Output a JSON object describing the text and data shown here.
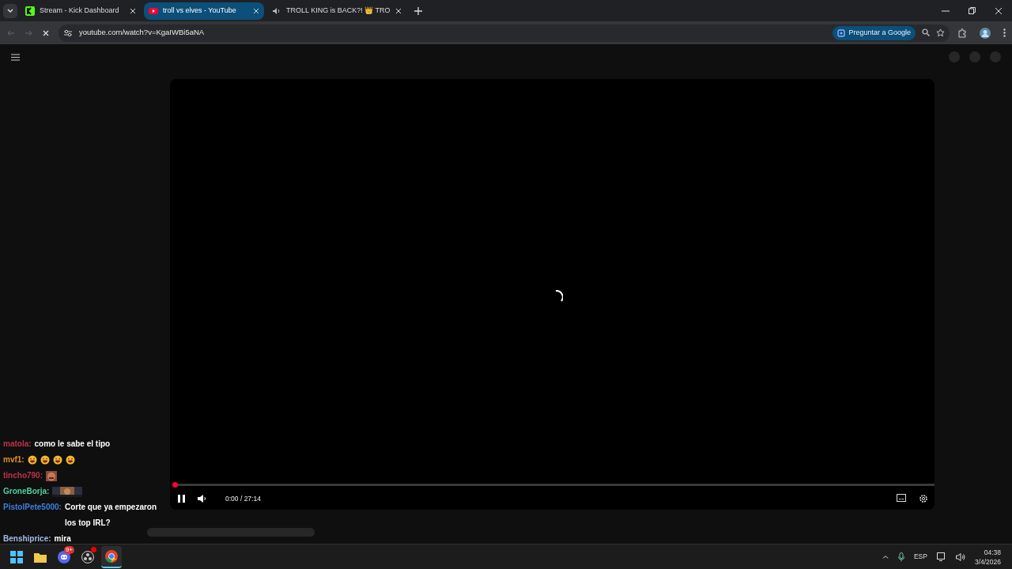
{
  "tabs": [
    {
      "title": "Stream - Kick Dashboard",
      "selected": false
    },
    {
      "title": "troll vs elves - YouTube",
      "selected": true
    },
    {
      "title": "TROLL KING is BACK?! 👑 TRO",
      "selected": false
    }
  ],
  "address": "youtube.com/watch?v=KgaIWBi5aNA",
  "ask_button": "Preguntar a Google",
  "player": {
    "loading": true,
    "playing": true,
    "level": 0,
    "time": "0:00 / 27:14"
  },
  "chat": [
    {
      "kind": "text",
      "user": "matola:",
      "color": "#c0304a",
      "text": "como le sabe el tipo"
    },
    {
      "kind": "emoji",
      "user": "mvf1:",
      "color": "#e0902a"
    },
    {
      "kind": "picture",
      "user": "tincho790:",
      "color": "#c0304a"
    },
    {
      "kind": "wide-picture",
      "user": "GroneBorja:",
      "color": "#4fd1a0"
    },
    {
      "kind": "text",
      "user": "PistolPete5000:",
      "color": "#3f7fe0",
      "text": "Corte que ya empezaron los top IRL?"
    },
    {
      "kind": "text",
      "user": "Benshiprice:",
      "color": "#a9b8e6",
      "text": "mira"
    }
  ],
  "taskbar": {
    "apps": [
      {
        "kind": "start",
        "selected": false
      },
      {
        "kind": "folder",
        "selected": false
      },
      {
        "kind": "discord",
        "selected": false,
        "badge": "9+"
      },
      {
        "kind": "obs",
        "selected": false,
        "notification": true
      },
      {
        "kind": "chrome",
        "selected": true
      }
    ],
    "language": "ESP",
    "time": "04:38",
    "date": "3/4/2026"
  }
}
